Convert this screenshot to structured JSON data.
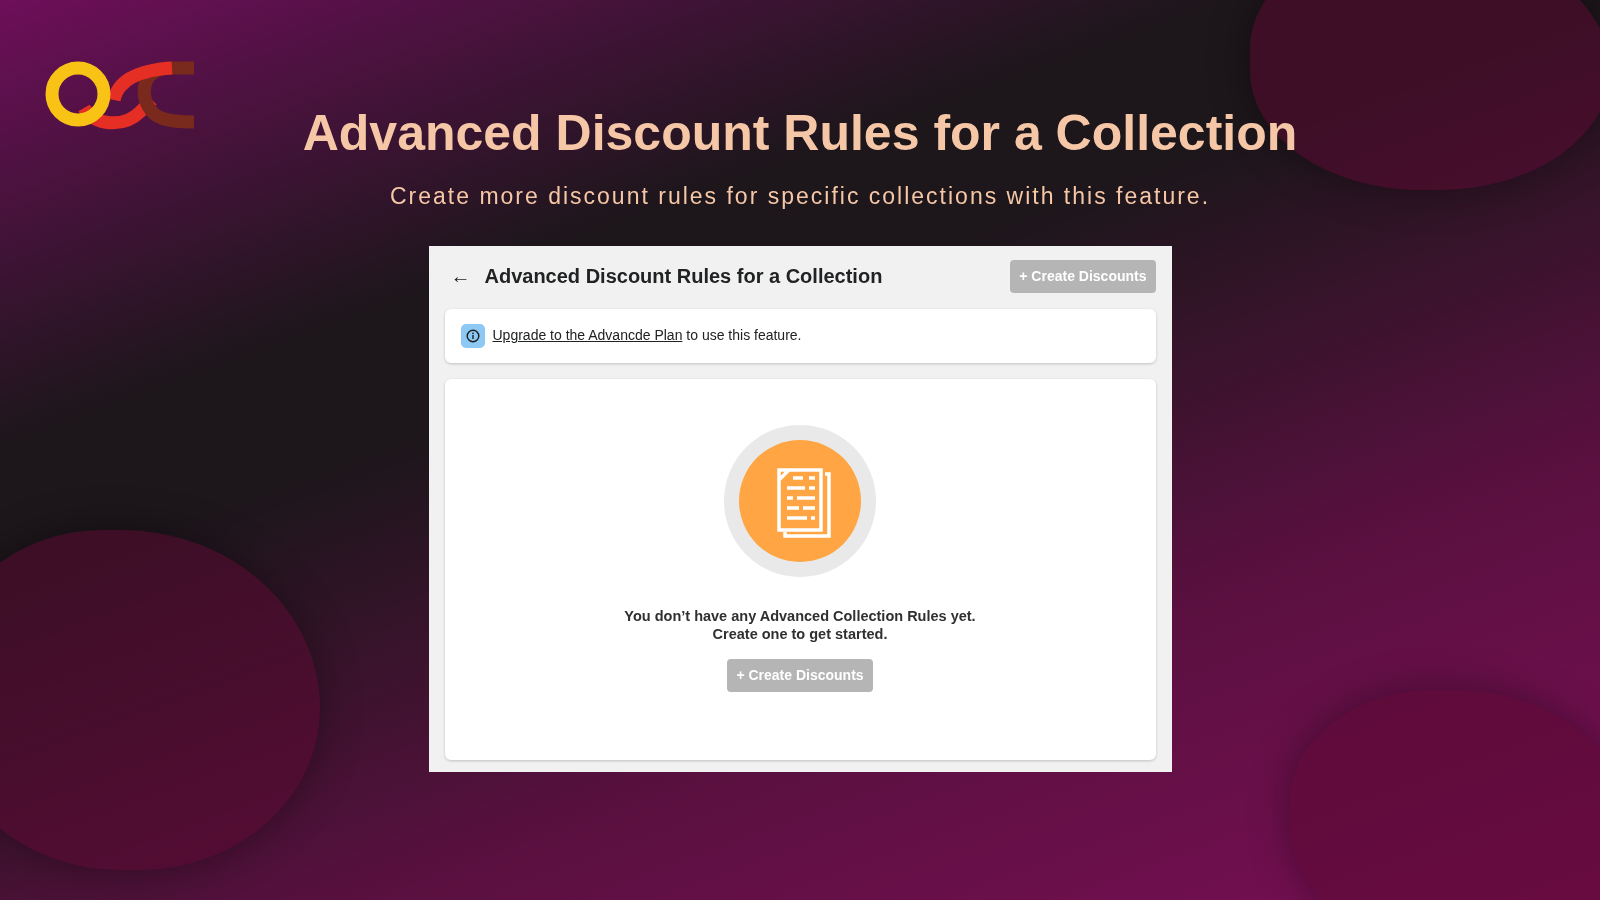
{
  "banner": {
    "title": "Advanced Discount Rules for a Collection",
    "subtitle": "Create more discount rules for specific collections with this feature."
  },
  "app": {
    "back": "←",
    "title": "Advanced Discount Rules for a Collection",
    "header_button": {
      "icon": "+",
      "label": "Create Discounts",
      "disabled": true
    },
    "notice": {
      "link": "Upgrade to the Advancde Plan",
      "text": " to use this feature."
    },
    "empty_state": {
      "lines": [
        "You don’t have any Advanced Collection Rules yet.",
        "Create one to get started."
      ],
      "button": {
        "icon": "+",
        "label": "Create Discounts",
        "disabled": true
      }
    }
  }
}
